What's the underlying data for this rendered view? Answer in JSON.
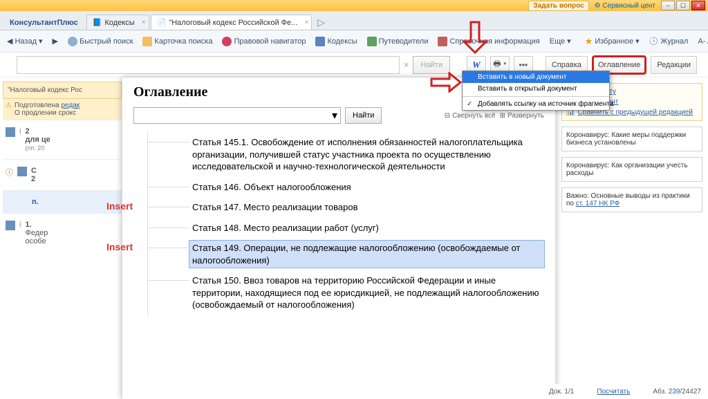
{
  "titlebar": {
    "ask": "Задать вопрос",
    "service": "Сервисный цент"
  },
  "appname": "КонсультантПлюс",
  "tabs": [
    {
      "label": "Кодексы"
    },
    {
      "label": "\"Налоговый кодекс Российской Фе..."
    }
  ],
  "toolbar": {
    "back": "Назад",
    "quick": "Быстрый поиск",
    "card": "Карточка поиска",
    "nav": "Правовой навигатор",
    "codex": "Кодексы",
    "guide": "Путеводители",
    "ref": "Справочная информация",
    "more": "Еще",
    "fav": "Избранное",
    "journal": "Журнал",
    "font": "A- A+"
  },
  "subbar": {
    "find": "Найти",
    "help": "Справка",
    "toc": "Оглавление",
    "editions": "Редакции"
  },
  "dropdown": {
    "opt1": "Вставить в новый документ",
    "opt2": "Вставить в открытый документ",
    "opt3": "Добавлять ссылку на источник фрагмента"
  },
  "left": {
    "doctitle": "\"Налоговый кодекс Рос",
    "warn1": "Подготовлена",
    "warn1link": "редак",
    "warn2": "О продлении срокс",
    "r1_a": "2",
    "r1_b": "для це",
    "r1_c": "(пп. 20",
    "r2_a": "С",
    "r2_b": "2",
    "r3": "п.",
    "r4_a": "1.",
    "r4_b": "Федер",
    "r4_c": "особе",
    "insert": "Insert"
  },
  "toc_title": "Оглавление",
  "toc_find": "Найти",
  "collapse": "Свернуть всё",
  "expand": "Развернуть",
  "toc": [
    "Статья 145.1. Освобождение от исполнения обязанностей налогоплательщика организации, получившей статус участника проекта по осуществлению исследовательской и научно-технологической деятельности",
    "Статья 146. Объект налогообложения",
    "Статья 147. Место реализации товаров",
    "Статья 148. Место реализации работ (услуг)",
    "Статья 149. Операции, не подлежащие налогообложению (освобождаемые от налогообложения)",
    "Статья 150. Ввоз товаров на территорию Российской Федерации и иные территории, находящиеся под ее юрисдикцией, не подлежащий налогообложению (освобождаемый от налогообложения)"
  ],
  "right": {
    "l1": "к документу",
    "l2": "ый документ",
    "compare": "Сравнить с предыдущей редакцией",
    "note1": "Коронавирус: Какие меры поддержки бизнеса установлены",
    "note2": "Коронавирус: Как организации учесть расходы",
    "note3_a": "Важно: Основные выводы из практики по",
    "note3_b": "ст. 147 НК РФ"
  },
  "footer": {
    "doc": "Док. 1/1",
    "calc": "Посчитать",
    "abz_lbl": "Абз.",
    "abz_cur": "239",
    "abz_total": "/24427"
  }
}
